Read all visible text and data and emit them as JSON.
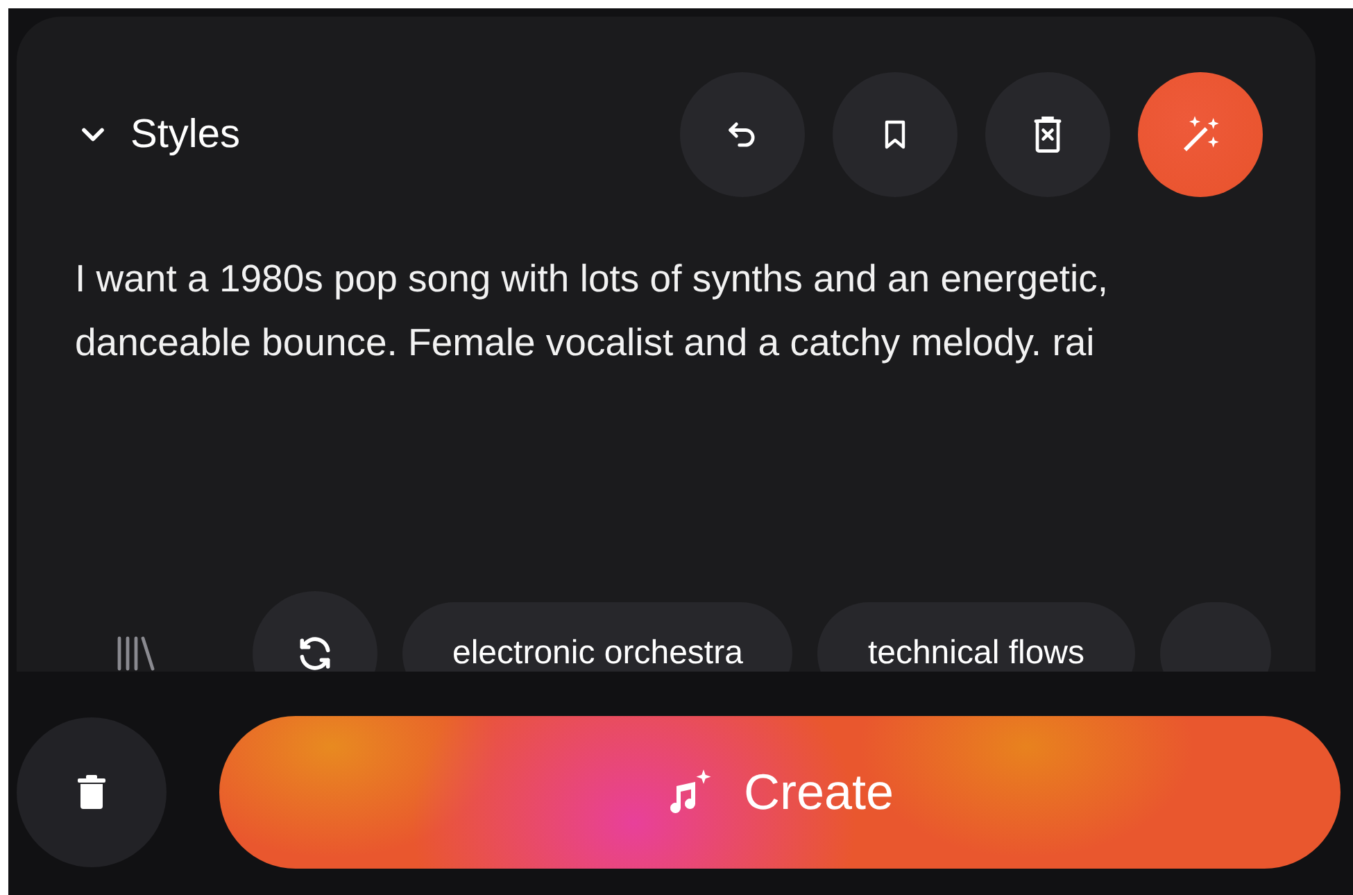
{
  "section": {
    "title": "Styles",
    "expanded": true
  },
  "actions": [
    {
      "kind": "undo"
    },
    {
      "kind": "bookmark"
    },
    {
      "kind": "clear"
    },
    {
      "kind": "enhance"
    }
  ],
  "prompt": {
    "value": "I want a 1980s pop song with lots of synths and an energetic, danceable bounce. Female vocalist and a catchy melody. rai"
  },
  "tags": [
    {
      "label": "electronic orchestra"
    },
    {
      "label": "technical flows"
    }
  ],
  "create_button": {
    "label": "Create"
  }
}
